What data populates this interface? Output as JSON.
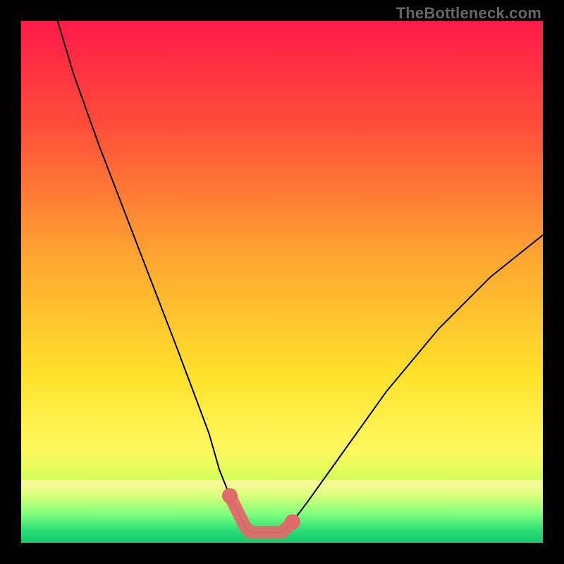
{
  "watermark": "TheBottleneck.com",
  "chart_data": {
    "type": "line",
    "title": "",
    "xlabel": "",
    "ylabel": "",
    "xlim": [
      0,
      100
    ],
    "ylim": [
      0,
      100
    ],
    "grid": false,
    "legend": false,
    "series": [
      {
        "name": "curve",
        "x": [
          7,
          10,
          15,
          20,
          25,
          30,
          33,
          36,
          38,
          40,
          42,
          43,
          44,
          46,
          48,
          50,
          52,
          55,
          60,
          65,
          70,
          75,
          80,
          85,
          90,
          95,
          100
        ],
        "values": [
          100,
          90,
          76,
          63,
          50,
          37,
          29,
          21,
          14,
          9,
          5,
          3,
          2,
          2,
          2,
          2,
          4,
          8,
          15,
          22,
          29,
          35,
          41,
          46,
          51,
          55,
          59
        ]
      }
    ],
    "highlight_segment": {
      "x": [
        40,
        42,
        43,
        44,
        46,
        48,
        50,
        52
      ],
      "values": [
        9,
        5,
        3,
        2,
        2,
        2,
        2,
        4
      ]
    },
    "gradient_stops": [
      {
        "pct": 0,
        "color": "#ff1a49"
      },
      {
        "pct": 20,
        "color": "#ff4d3a"
      },
      {
        "pct": 45,
        "color": "#ffa531"
      },
      {
        "pct": 68,
        "color": "#ffe22b"
      },
      {
        "pct": 82,
        "color": "#fff85f"
      },
      {
        "pct": 90,
        "color": "#c8ff5a"
      },
      {
        "pct": 96,
        "color": "#5dff7a"
      },
      {
        "pct": 100,
        "color": "#18e06c"
      }
    ],
    "green_band_stops": [
      {
        "pct": 0,
        "color": "#fdf7a0"
      },
      {
        "pct": 25,
        "color": "#d9ff79"
      },
      {
        "pct": 55,
        "color": "#7cff7c"
      },
      {
        "pct": 80,
        "color": "#2bde77"
      },
      {
        "pct": 100,
        "color": "#14c96a"
      }
    ]
  }
}
